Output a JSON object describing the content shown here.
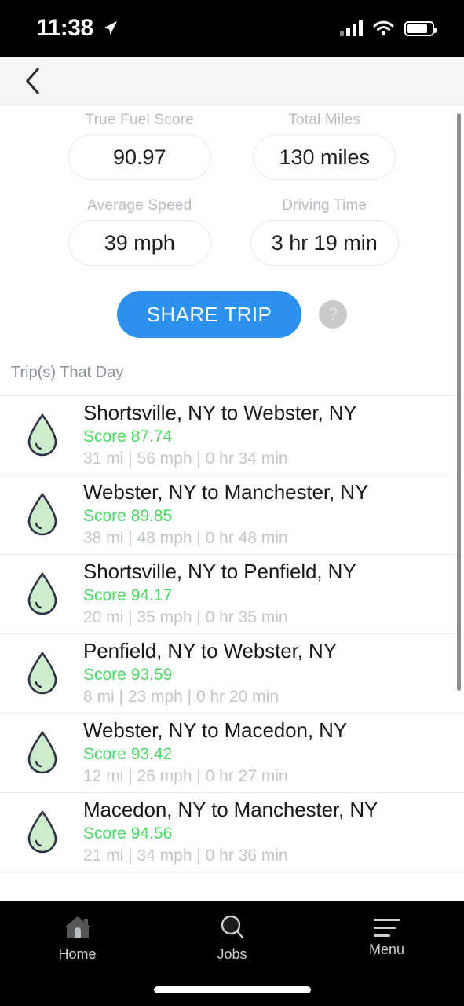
{
  "status_bar": {
    "time": "11:38",
    "location_icon": "location-arrow-icon",
    "signal_icon": "cellular-signal-icon",
    "wifi_icon": "wifi-icon",
    "battery_icon": "battery-icon"
  },
  "header": {
    "back_icon": "chevron-left-icon"
  },
  "summary": {
    "stats": [
      {
        "label": "True Fuel Score",
        "value": "90.97"
      },
      {
        "label": "Total Miles",
        "value": "130 miles"
      },
      {
        "label": "Average Speed",
        "value": "39 mph"
      },
      {
        "label": "Driving Time",
        "value": "3 hr 19 min"
      }
    ],
    "share_label": "SHARE TRIP",
    "help_label": "?",
    "accent_color": "#2b90ee"
  },
  "trips_section": {
    "label": "Trip(s) That Day",
    "score_color": "#4bd964",
    "items": [
      {
        "icon": "fuel-droplet-icon",
        "title": "Shortsville, NY to Webster, NY",
        "score": "Score 87.74",
        "meta": "31 mi | 56 mph | 0 hr 34 min"
      },
      {
        "icon": "fuel-droplet-icon",
        "title": "Webster, NY to Manchester, NY",
        "score": "Score 89.85",
        "meta": "38 mi | 48 mph | 0 hr 48 min"
      },
      {
        "icon": "fuel-droplet-icon",
        "title": "Shortsville, NY to Penfield, NY",
        "score": "Score 94.17",
        "meta": "20 mi | 35 mph | 0 hr 35 min"
      },
      {
        "icon": "fuel-droplet-icon",
        "title": "Penfield, NY to Webster, NY",
        "score": "Score 93.59",
        "meta": "8 mi | 23 mph | 0 hr 20 min"
      },
      {
        "icon": "fuel-droplet-icon",
        "title": "Webster, NY to Macedon, NY",
        "score": "Score 93.42",
        "meta": "12 mi | 26 mph | 0 hr 27 min"
      },
      {
        "icon": "fuel-droplet-icon",
        "title": "Macedon, NY to Manchester, NY",
        "score": "Score 94.56",
        "meta": "21 mi | 34 mph | 0 hr 36 min"
      }
    ]
  },
  "tab_bar": {
    "tabs": [
      {
        "label": "Home",
        "icon": "home-icon"
      },
      {
        "label": "Jobs",
        "icon": "search-icon"
      },
      {
        "label": "Menu",
        "icon": "hamburger-menu-icon"
      }
    ]
  }
}
